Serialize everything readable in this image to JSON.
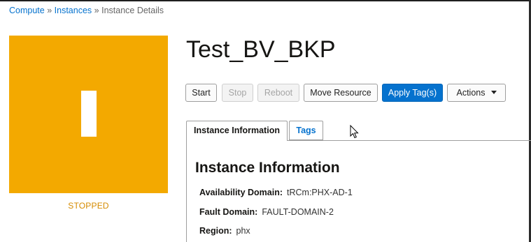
{
  "breadcrumb": {
    "items": [
      "Compute",
      "Instances"
    ],
    "separator": "»",
    "current": "Instance Details"
  },
  "instance": {
    "name": "Test_BV_BKP",
    "icon_letter": "I",
    "state": "STOPPED"
  },
  "toolbar": {
    "start": "Start",
    "stop": "Stop",
    "reboot": "Reboot",
    "move_resource": "Move Resource",
    "apply_tags": "Apply Tag(s)",
    "actions": "Actions"
  },
  "tabs": [
    {
      "label": "Instance Information",
      "active": true
    },
    {
      "label": "Tags",
      "active": false
    }
  ],
  "info": {
    "section_title": "Instance Information",
    "fields": [
      {
        "label": "Availability Domain:",
        "value": "tRCm:PHX-AD-1"
      },
      {
        "label": "Fault Domain:",
        "value": "FAULT-DOMAIN-2"
      },
      {
        "label": "Region:",
        "value": "phx"
      }
    ]
  },
  "colors": {
    "accent": "#0572ce",
    "badge": "#f3a900",
    "state_text": "#d58b00"
  }
}
